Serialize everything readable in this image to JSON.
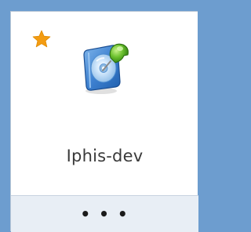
{
  "card": {
    "title": "Iphis-dev",
    "favorite_icon": "star-icon",
    "app_icon": "pinned-disc-icon",
    "more_label": "• • •",
    "colors": {
      "background": "#6d9dcf",
      "star": "#f39c12",
      "footer": "#e8eef5"
    }
  }
}
